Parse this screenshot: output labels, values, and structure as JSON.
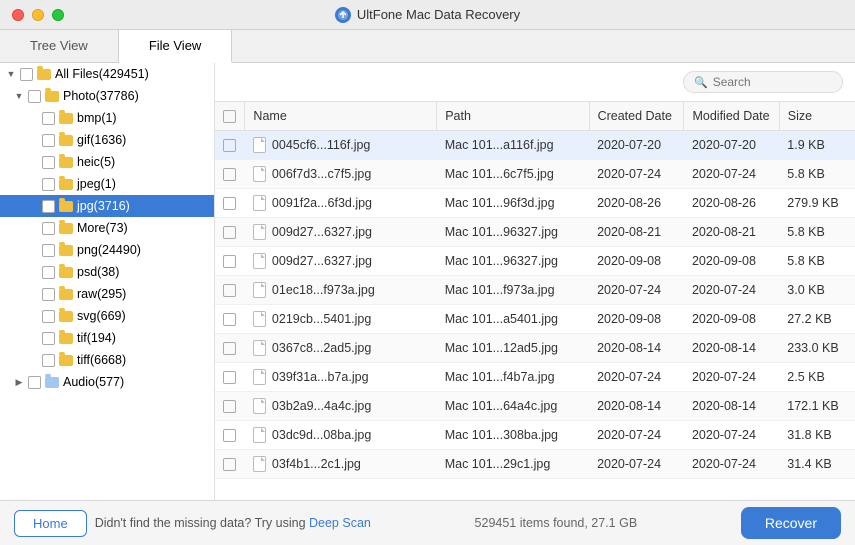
{
  "app": {
    "title": "UltFone Mac Data Recovery"
  },
  "tabs": [
    {
      "id": "tree-view",
      "label": "Tree View",
      "active": false
    },
    {
      "id": "file-view",
      "label": "File View",
      "active": true
    }
  ],
  "search": {
    "placeholder": "Search"
  },
  "sidebar": {
    "items": [
      {
        "id": "all-files",
        "label": "All Files(429451)",
        "level": 0,
        "expanded": true,
        "checked": false,
        "icon": "folder"
      },
      {
        "id": "photo",
        "label": "Photo(37786)",
        "level": 1,
        "expanded": true,
        "checked": false,
        "icon": "folder"
      },
      {
        "id": "bmp",
        "label": "bmp(1)",
        "level": 2,
        "checked": false,
        "icon": "folder"
      },
      {
        "id": "gif",
        "label": "gif(1636)",
        "level": 2,
        "checked": false,
        "icon": "folder"
      },
      {
        "id": "heic",
        "label": "heic(5)",
        "level": 2,
        "checked": false,
        "icon": "folder"
      },
      {
        "id": "jpeg",
        "label": "jpeg(1)",
        "level": 2,
        "checked": false,
        "icon": "folder"
      },
      {
        "id": "jpg",
        "label": "jpg(3716)",
        "level": 2,
        "checked": false,
        "icon": "folder",
        "highlighted": true
      },
      {
        "id": "more",
        "label": "More(73)",
        "level": 2,
        "checked": false,
        "icon": "folder"
      },
      {
        "id": "png",
        "label": "png(24490)",
        "level": 2,
        "checked": false,
        "icon": "folder"
      },
      {
        "id": "psd",
        "label": "psd(38)",
        "level": 2,
        "checked": false,
        "icon": "folder"
      },
      {
        "id": "raw",
        "label": "raw(295)",
        "level": 2,
        "checked": false,
        "icon": "folder"
      },
      {
        "id": "svg",
        "label": "svg(669)",
        "level": 2,
        "checked": false,
        "icon": "folder"
      },
      {
        "id": "tif",
        "label": "tif(194)",
        "level": 2,
        "checked": false,
        "icon": "folder"
      },
      {
        "id": "tiff",
        "label": "tiff(6668)",
        "level": 2,
        "checked": false,
        "icon": "folder"
      },
      {
        "id": "audio",
        "label": "Audio(577)",
        "level": 1,
        "expanded": false,
        "checked": false,
        "icon": "audio"
      }
    ]
  },
  "table": {
    "columns": [
      {
        "id": "name",
        "label": "Name"
      },
      {
        "id": "path",
        "label": "Path"
      },
      {
        "id": "created",
        "label": "Created Date"
      },
      {
        "id": "modified",
        "label": "Modified Date"
      },
      {
        "id": "size",
        "label": "Size"
      }
    ],
    "rows": [
      {
        "name": "0045cf6...116f.jpg",
        "path": "Mac 101...a116f.jpg",
        "created": "2020-07-20",
        "modified": "2020-07-20",
        "size": "1.9 KB",
        "highlighted": true
      },
      {
        "name": "006f7d3...c7f5.jpg",
        "path": "Mac 101...6c7f5.jpg",
        "created": "2020-07-24",
        "modified": "2020-07-24",
        "size": "5.8 KB"
      },
      {
        "name": "0091f2a...6f3d.jpg",
        "path": "Mac 101...96f3d.jpg",
        "created": "2020-08-26",
        "modified": "2020-08-26",
        "size": "279.9 KB"
      },
      {
        "name": "009d27...6327.jpg",
        "path": "Mac 101...96327.jpg",
        "created": "2020-08-21",
        "modified": "2020-08-21",
        "size": "5.8 KB"
      },
      {
        "name": "009d27...6327.jpg",
        "path": "Mac 101...96327.jpg",
        "created": "2020-09-08",
        "modified": "2020-09-08",
        "size": "5.8 KB"
      },
      {
        "name": "01ec18...f973a.jpg",
        "path": "Mac 101...f973a.jpg",
        "created": "2020-07-24",
        "modified": "2020-07-24",
        "size": "3.0 KB"
      },
      {
        "name": "0219cb...5401.jpg",
        "path": "Mac 101...a5401.jpg",
        "created": "2020-09-08",
        "modified": "2020-09-08",
        "size": "27.2 KB"
      },
      {
        "name": "0367c8...2ad5.jpg",
        "path": "Mac 101...12ad5.jpg",
        "created": "2020-08-14",
        "modified": "2020-08-14",
        "size": "233.0 KB"
      },
      {
        "name": "039f31a...b7a.jpg",
        "path": "Mac 101...f4b7a.jpg",
        "created": "2020-07-24",
        "modified": "2020-07-24",
        "size": "2.5 KB"
      },
      {
        "name": "03b2a9...4a4c.jpg",
        "path": "Mac 101...64a4c.jpg",
        "created": "2020-08-14",
        "modified": "2020-08-14",
        "size": "172.1 KB"
      },
      {
        "name": "03dc9d...08ba.jpg",
        "path": "Mac 101...308ba.jpg",
        "created": "2020-07-24",
        "modified": "2020-07-24",
        "size": "31.8 KB"
      },
      {
        "name": "03f4b1...2c1.jpg",
        "path": "Mac 101...29c1.jpg",
        "created": "2020-07-24",
        "modified": "2020-07-24",
        "size": "31.4 KB"
      }
    ]
  },
  "footer": {
    "home_label": "Home",
    "message": "Didn't find the missing data? Try using ",
    "deep_scan_label": "Deep Scan",
    "stats": "529451 items found, 27.1 GB",
    "recover_label": "Recover"
  }
}
